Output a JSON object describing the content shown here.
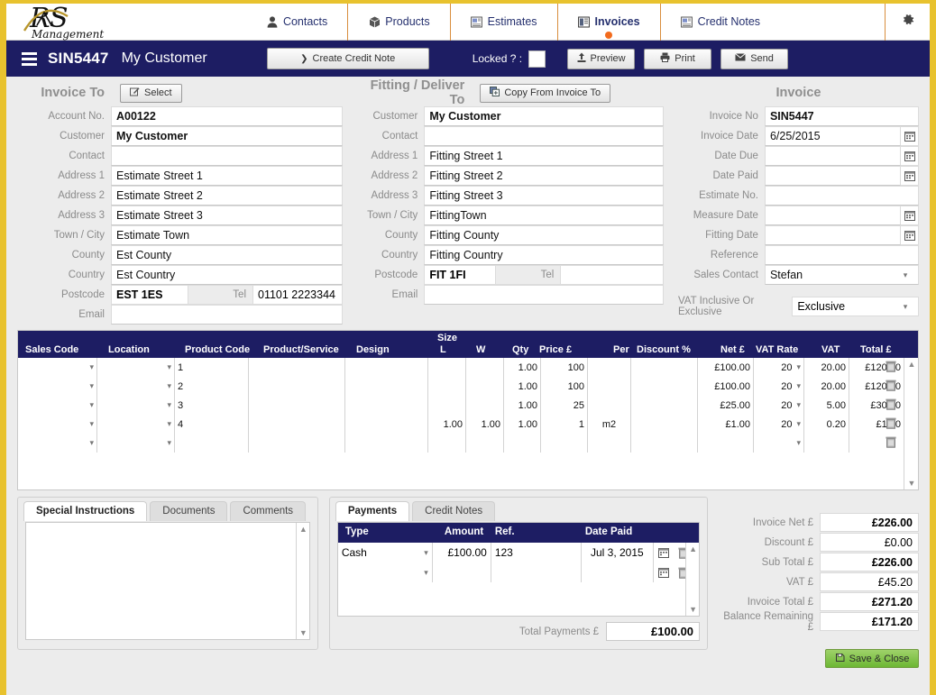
{
  "nav": {
    "items": [
      {
        "label": "Contacts",
        "icon": "person-icon",
        "active": false
      },
      {
        "label": "Products",
        "icon": "box-icon",
        "active": false
      },
      {
        "label": "Estimates",
        "icon": "document-icon",
        "active": false
      },
      {
        "label": "Invoices",
        "icon": "invoice-icon",
        "active": true
      },
      {
        "label": "Credit Notes",
        "icon": "document-icon",
        "active": false
      }
    ],
    "settings_icon": "gear-icon",
    "logo_text": "RS Management"
  },
  "titlebar": {
    "menu_icon": "hamburger-icon",
    "invoice_no": "SIN5447",
    "customer": "My Customer",
    "create_credit_note": "Create Credit Note",
    "locked_label": "Locked ? :",
    "locked_checked": false,
    "preview": "Preview",
    "print": "Print",
    "send": "Send"
  },
  "invoice_to": {
    "title": "Invoice To",
    "select_button": "Select",
    "fields": [
      {
        "label": "Account No.",
        "value": "A00122",
        "bold": true
      },
      {
        "label": "Customer",
        "value": "My Customer",
        "bold": true
      },
      {
        "label": "Contact",
        "value": "",
        "bold": false
      },
      {
        "label": "Address 1",
        "value": "Estimate Street 1",
        "bold": false
      },
      {
        "label": "Address 2",
        "value": "Estimate Street 2",
        "bold": false
      },
      {
        "label": "Address 3",
        "value": "Estimate Street 3",
        "bold": false
      },
      {
        "label": "Town / City",
        "value": "Estimate Town",
        "bold": false
      },
      {
        "label": "County",
        "value": "Est County",
        "bold": false
      },
      {
        "label": "Country",
        "value": "Est Country",
        "bold": false
      }
    ],
    "postcode_label": "Postcode",
    "postcode": "EST 1ES",
    "tel_label": "Tel",
    "tel": "01101 2223344",
    "email_label": "Email",
    "email": ""
  },
  "deliver_to": {
    "title": "Fitting / Deliver To",
    "copy_button": "Copy From Invoice To",
    "fields": [
      {
        "label": "Customer",
        "value": "My Customer",
        "bold": true
      },
      {
        "label": "Contact",
        "value": "",
        "bold": false
      },
      {
        "label": "Address 1",
        "value": "Fitting Street 1",
        "bold": false
      },
      {
        "label": "Address 2",
        "value": "Fitting Street 2",
        "bold": false
      },
      {
        "label": "Address 3",
        "value": "Fitting Street 3",
        "bold": false
      },
      {
        "label": "Town / City",
        "value": "FittingTown",
        "bold": false
      },
      {
        "label": "County",
        "value": "Fitting County",
        "bold": false
      },
      {
        "label": "Country",
        "value": "Fitting Country",
        "bold": false
      }
    ],
    "postcode_label": "Postcode",
    "postcode": "FIT 1FI",
    "tel_label": "Tel",
    "tel": "",
    "email_label": "Email",
    "email": ""
  },
  "invoice": {
    "title": "Invoice",
    "fields": [
      {
        "label": "Invoice No",
        "value": "SIN5447",
        "bold": true,
        "calendar": false,
        "dropdown": false
      },
      {
        "label": "Invoice Date",
        "value": "6/25/2015",
        "bold": false,
        "calendar": true,
        "dropdown": false
      },
      {
        "label": "Date Due",
        "value": "",
        "bold": false,
        "calendar": true,
        "dropdown": false
      },
      {
        "label": "Date Paid",
        "value": "",
        "bold": false,
        "calendar": true,
        "dropdown": false
      },
      {
        "label": "Estimate No.",
        "value": "",
        "bold": false,
        "calendar": false,
        "dropdown": false
      },
      {
        "label": "Measure Date",
        "value": "",
        "bold": false,
        "calendar": true,
        "dropdown": false
      },
      {
        "label": "Fitting Date",
        "value": "",
        "bold": false,
        "calendar": true,
        "dropdown": false
      },
      {
        "label": "Reference",
        "value": "",
        "bold": false,
        "calendar": false,
        "dropdown": false
      },
      {
        "label": "Sales Contact",
        "value": "Stefan",
        "bold": false,
        "calendar": false,
        "dropdown": true
      }
    ],
    "vat_mode_label": "VAT Inclusive Or Exclusive",
    "vat_mode_value": "Exclusive"
  },
  "grid": {
    "size_group": "Size",
    "columns": [
      "Sales Code",
      "Location",
      "Product Code",
      "Product/Service",
      "Design",
      "L",
      "W",
      "Qty",
      "Price £",
      "Per",
      "Discount %",
      "Net £",
      "VAT Rate",
      "VAT",
      "Total £"
    ],
    "rows": [
      {
        "sales_code": "",
        "location": "",
        "product_code": "1",
        "product_service": "",
        "design": "",
        "l": "",
        "w": "",
        "qty": "1.00",
        "price": "100",
        "per": "",
        "discount": "",
        "net": "£100.00",
        "vat_rate": "20",
        "vat": "20.00",
        "total": "£120.00"
      },
      {
        "sales_code": "",
        "location": "",
        "product_code": "2",
        "product_service": "",
        "design": "",
        "l": "",
        "w": "",
        "qty": "1.00",
        "price": "100",
        "per": "",
        "discount": "",
        "net": "£100.00",
        "vat_rate": "20",
        "vat": "20.00",
        "total": "£120.00"
      },
      {
        "sales_code": "",
        "location": "",
        "product_code": "3",
        "product_service": "",
        "design": "",
        "l": "",
        "w": "",
        "qty": "1.00",
        "price": "25",
        "per": "",
        "discount": "",
        "net": "£25.00",
        "vat_rate": "20",
        "vat": "5.00",
        "total": "£30.00"
      },
      {
        "sales_code": "",
        "location": "",
        "product_code": "4",
        "product_service": "",
        "design": "",
        "l": "1.00",
        "w": "1.00",
        "qty": "1.00",
        "price": "1",
        "per": "m2",
        "discount": "",
        "net": "£1.00",
        "vat_rate": "20",
        "vat": "0.20",
        "total": "£1.20"
      },
      {
        "sales_code": "",
        "location": "",
        "product_code": "",
        "product_service": "",
        "design": "",
        "l": "",
        "w": "",
        "qty": "",
        "price": "",
        "per": "",
        "discount": "",
        "net": "",
        "vat_rate": "",
        "vat": "",
        "total": ""
      }
    ]
  },
  "notes_tabs": {
    "tabs": [
      "Special Instructions",
      "Documents",
      "Comments"
    ],
    "active": "Special Instructions",
    "text": ""
  },
  "payments": {
    "tabs": [
      "Payments",
      "Credit Notes"
    ],
    "active": "Payments",
    "columns": [
      "Type",
      "Amount",
      "Ref.",
      "Date Paid"
    ],
    "rows": [
      {
        "type": "Cash",
        "amount": "£100.00",
        "ref": "123",
        "date_paid": "Jul 3, 2015"
      },
      {
        "type": "",
        "amount": "",
        "ref": "",
        "date_paid": ""
      }
    ],
    "total_label": "Total Payments £",
    "total_value": "£100.00"
  },
  "totals": {
    "rows": [
      {
        "label": "Invoice Net £",
        "value": "£226.00",
        "bold": true
      },
      {
        "label": "Discount £",
        "value": "£0.00",
        "bold": false
      },
      {
        "label": "Sub Total £",
        "value": "£226.00",
        "bold": true
      },
      {
        "label": "VAT £",
        "value": "£45.20",
        "bold": false
      },
      {
        "label": "Invoice Total £",
        "value": "£271.20",
        "bold": true
      },
      {
        "label": "Balance Remaining £",
        "value": "£171.20",
        "bold": true
      }
    ],
    "save_label": "Save & Close"
  },
  "colors": {
    "navy": "#1d1d63",
    "gold": "#e8c22e",
    "accent_orange": "#f26b1d",
    "save_green": "#6cb734",
    "panel_grey": "#ececec"
  }
}
